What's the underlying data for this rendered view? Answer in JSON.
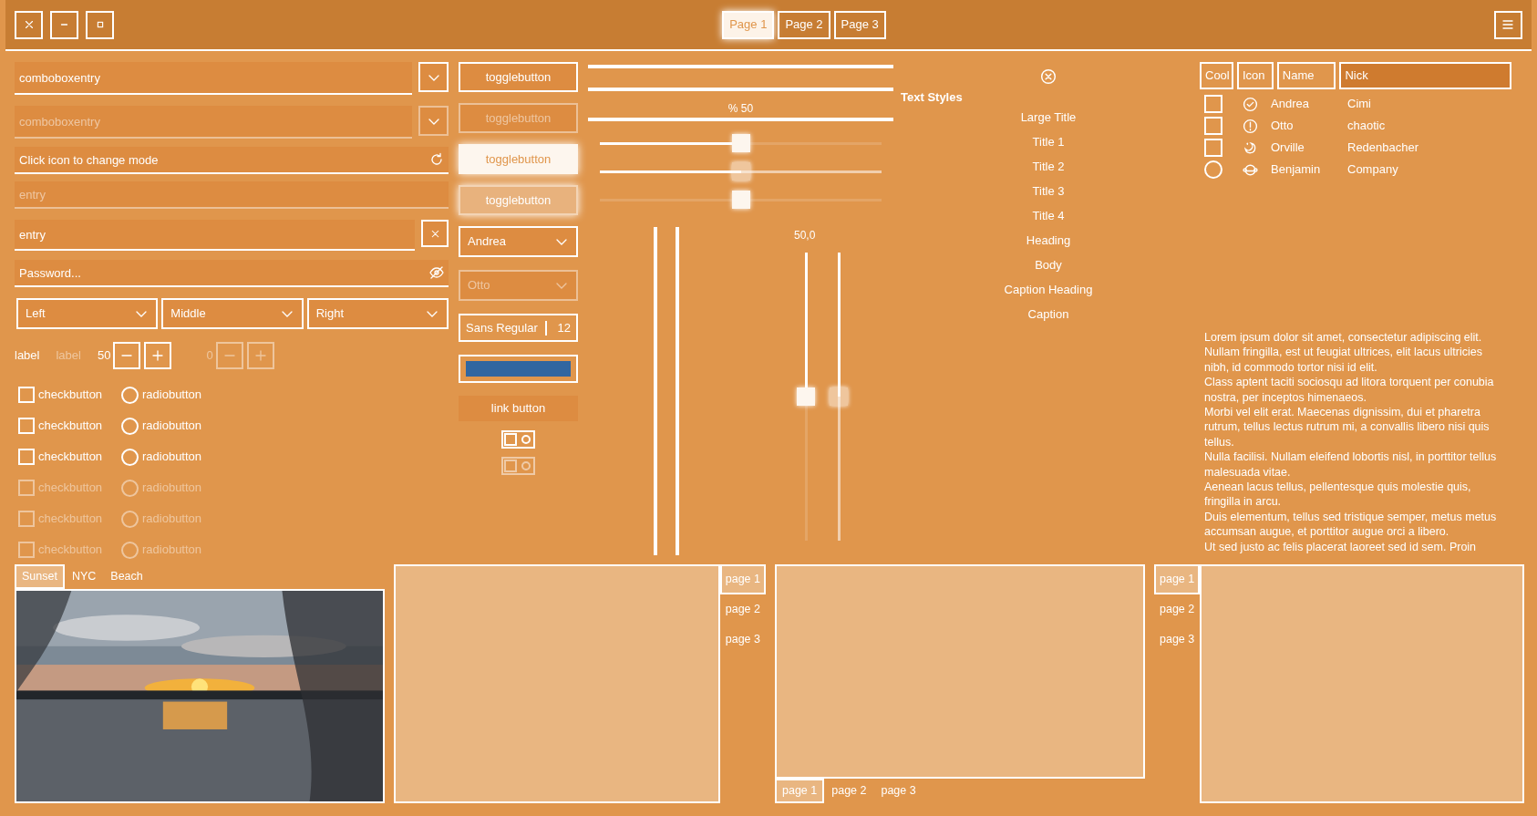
{
  "header": {
    "tabs": [
      {
        "label": "Page 1",
        "selected": true
      },
      {
        "label": "Page 2",
        "selected": false
      },
      {
        "label": "Page 3",
        "selected": false
      }
    ]
  },
  "entries": [
    {
      "kind": "combo",
      "value": "comboboxentry",
      "disabled": false
    },
    {
      "kind": "combo",
      "value": "comboboxentry",
      "disabled": true
    },
    {
      "kind": "mode",
      "value": "Click icon to change mode",
      "disabled": false
    },
    {
      "kind": "plain",
      "value": "entry",
      "disabled": true
    },
    {
      "kind": "clear",
      "value": "entry",
      "disabled": false
    },
    {
      "kind": "password",
      "placeholder": "Password...",
      "disabled": false
    }
  ],
  "dropdowns": [
    "Left",
    "Middle",
    "Right"
  ],
  "labels": [
    {
      "text": "label",
      "disabled": false
    },
    {
      "text": "label",
      "disabled": true
    }
  ],
  "spinbuttons": [
    {
      "value": "50",
      "disabled": false
    },
    {
      "value": "0",
      "disabled": true
    }
  ],
  "checkbuttons": [
    {
      "label": "checkbutton",
      "checked": false,
      "disabled": false
    },
    {
      "label": "checkbutton",
      "checked": false,
      "disabled": false
    },
    {
      "label": "checkbutton",
      "checked": false,
      "disabled": false
    },
    {
      "label": "checkbutton",
      "checked": false,
      "disabled": true
    },
    {
      "label": "checkbutton",
      "checked": false,
      "disabled": true
    },
    {
      "label": "checkbutton",
      "checked": false,
      "disabled": true
    }
  ],
  "radiobuttons": [
    {
      "label": "radiobutton",
      "selected": false,
      "disabled": false
    },
    {
      "label": "radiobutton",
      "selected": false,
      "disabled": false
    },
    {
      "label": "radiobutton",
      "selected": false,
      "disabled": false
    },
    {
      "label": "radiobutton",
      "selected": false,
      "disabled": true
    },
    {
      "label": "radiobutton",
      "selected": false,
      "disabled": true
    },
    {
      "label": "radiobutton",
      "selected": false,
      "disabled": true
    }
  ],
  "togglebuttons": [
    {
      "label": "togglebutton",
      "active": false,
      "disabled": false
    },
    {
      "label": "togglebutton",
      "active": false,
      "disabled": true
    },
    {
      "label": "togglebutton",
      "active": true,
      "disabled": false
    },
    {
      "label": "togglebutton",
      "active": true,
      "disabled": true
    }
  ],
  "combos": [
    {
      "value": "Andrea",
      "disabled": false
    },
    {
      "value": "Otto",
      "disabled": true
    }
  ],
  "font_button": {
    "family": "Sans Regular",
    "size": "12"
  },
  "color_button": {
    "color": "#3166a0"
  },
  "link_button": {
    "label": "link button"
  },
  "switches": [
    {
      "on": false,
      "disabled": false
    },
    {
      "on": false,
      "disabled": true
    }
  ],
  "progress_bars": [
    {
      "level": 1
    },
    {
      "level": 1
    },
    {
      "level": 1,
      "text": "% 50"
    }
  ],
  "scales": [
    {
      "level": 0.5,
      "disabled": false,
      "has_origin": true
    },
    {
      "level": 0.5,
      "disabled": true,
      "has_origin": true
    },
    {
      "level": 0.5,
      "disabled": false,
      "has_origin": false
    }
  ],
  "vertical_progress": [
    {
      "level": 1
    },
    {
      "level": 1
    }
  ],
  "vertical_scales": {
    "value": "50,0",
    "items": [
      {
        "level": 0.5,
        "disabled": false
      },
      {
        "level": 0.5,
        "disabled": true
      }
    ]
  },
  "text_styles": {
    "title": "Text Styles",
    "items": [
      "Large Title",
      "Title 1",
      "Title 2",
      "Title 3",
      "Title 4",
      "Heading",
      "Body",
      "Caption Heading",
      "Caption"
    ]
  },
  "tree": {
    "columns": [
      {
        "label": "Cool",
        "sorted": false
      },
      {
        "label": "Icon",
        "sorted": false
      },
      {
        "label": "Name",
        "sorted": false
      },
      {
        "label": "Nick",
        "sorted": true
      }
    ],
    "rows": [
      {
        "kind": "check",
        "checked": false,
        "name": "Andrea",
        "nick": "Cimi"
      },
      {
        "kind": "check",
        "checked": false,
        "name": "Otto",
        "nick": "chaotic"
      },
      {
        "kind": "check",
        "checked": false,
        "name": "Orville",
        "nick": "Redenbacher"
      },
      {
        "kind": "radio",
        "checked": false,
        "name": "Benjamin",
        "nick": "Company"
      }
    ]
  },
  "text_view": {
    "paragraphs": [
      "Lorem ipsum dolor sit amet, consectetur adipiscing elit. Nullam fringilla, est ut feugiat ultrices, elit lacus ultricies nibh, id commodo tortor nisi id elit.",
      "Class aptent taciti sociosqu ad litora torquent per conubia nostra, per inceptos himenaeos.",
      "Morbi vel elit erat. Maecenas dignissim, dui et pharetra rutrum, tellus lectus rutrum mi, a convallis libero nisi quis tellus.",
      "Nulla facilisi. Nullam eleifend lobortis nisl, in porttitor tellus malesuada vitae.",
      "Aenean lacus tellus, pellentesque quis molestie quis, fringilla in arcu.",
      "Duis elementum, tellus sed tristique semper, metus metus accumsan augue, et porttitor augue orci a libero.",
      "Ut sed justo ac felis placerat laoreet sed id sem. Proin"
    ]
  },
  "notebooks": [
    {
      "kind": "top",
      "page": {
        "kind": "picture"
      },
      "tabs": [
        {
          "label": "Sunset",
          "selected": true
        },
        {
          "label": "NYC",
          "selected": false
        },
        {
          "label": "Beach",
          "selected": false
        }
      ]
    },
    {
      "kind": "right",
      "tabs": [
        {
          "label": "page 1",
          "selected": true
        },
        {
          "label": "page 2",
          "selected": false
        },
        {
          "label": "page 3",
          "selected": false
        }
      ]
    },
    {
      "kind": "bottom",
      "tabs": [
        {
          "label": "page 1",
          "selected": true
        },
        {
          "label": "page 2",
          "selected": false
        },
        {
          "label": "page 3",
          "selected": false
        }
      ]
    },
    {
      "kind": "left",
      "tabs": [
        {
          "label": "page 1",
          "selected": true
        },
        {
          "label": "page 2",
          "selected": false
        },
        {
          "label": "page 3",
          "selected": false
        }
      ]
    }
  ]
}
